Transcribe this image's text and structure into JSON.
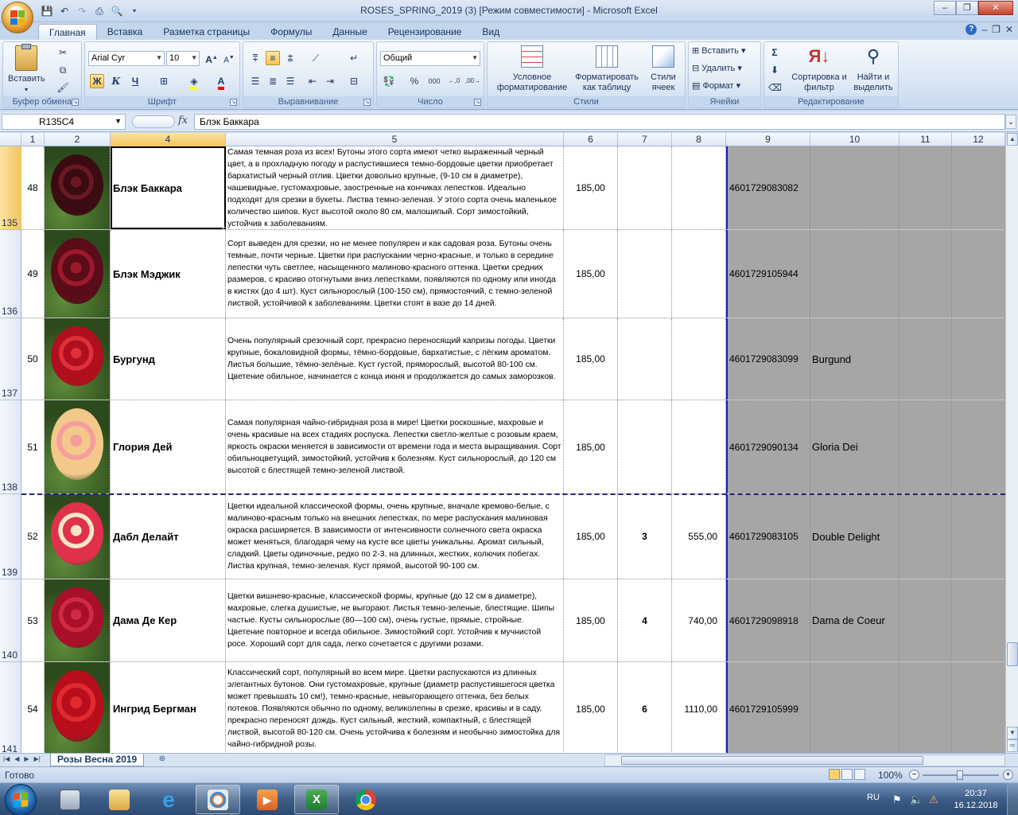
{
  "window": {
    "title": "ROSES_SPRING_2019 (3)  [Режим совместимости] - Microsoft Excel",
    "minimize": "–",
    "restore": "❐",
    "close": "✕"
  },
  "ribbon_tabs": [
    "Главная",
    "Вставка",
    "Разметка страницы",
    "Формулы",
    "Данные",
    "Рецензирование",
    "Вид"
  ],
  "ribbon": {
    "clipboard": {
      "label": "Буфер обмена",
      "paste": "Вставить"
    },
    "font": {
      "label": "Шрифт",
      "family": "Arial Cyr",
      "size": "10",
      "bold": "Ж",
      "italic": "К",
      "underline": "Ч"
    },
    "alignment": {
      "label": "Выравнивание"
    },
    "number": {
      "label": "Число",
      "format": "Общий",
      "percent": "%",
      "thousands": "000"
    },
    "styles": {
      "label": "Стили",
      "conditional": "Условное форматирование",
      "as_table": "Форматировать как таблицу",
      "cell_styles": "Стили ячеек"
    },
    "cells": {
      "label": "Ячейки",
      "insert": "Вставить",
      "delete": "Удалить",
      "format": "Формат"
    },
    "editing": {
      "label": "Редактирование",
      "sigma": "Σ",
      "sort": "Сортировка и фильтр",
      "find": "Найти и выделить"
    }
  },
  "formula_bar": {
    "name_box": "R135C4",
    "fx": "fx",
    "content": "Блэк Баккара"
  },
  "columns": [
    {
      "label": "1",
      "width": 29
    },
    {
      "label": "2",
      "width": 83
    },
    {
      "label": "4",
      "width": 145
    },
    {
      "label": "5",
      "width": 425
    },
    {
      "label": "6",
      "width": 68
    },
    {
      "label": "7",
      "width": 68
    },
    {
      "label": "8",
      "width": 68
    },
    {
      "label": "9",
      "width": 106
    },
    {
      "label": "10",
      "width": 112
    },
    {
      "label": "11",
      "width": 66
    },
    {
      "label": "12",
      "width": 67
    }
  ],
  "selected_column": "4",
  "rows": [
    {
      "rownum": "135",
      "n": "48",
      "name": "Блэк Баккара",
      "desc": "Самая темная роза из всех! Бутоны этого сорта имеют четко выраженный черный цвет, а в прохладную погоду и распустившиеся темно-бордовые цветки приобретает бархатистый черный отлив. Цветки довольно крупные, (9-10 см в диаметре), чашевидные, густомахровые, заостренные на кончиках лепестков. Идеально подходят для срезки в букеты. Листва темно-зеленая. У этого сорта очень маленькое количество шипов. Куст высотой около 80 см, малошипый. Сорт зимостойкий, устойчив к заболеваниям.",
      "price": "185,00",
      "qty": "",
      "sum": "",
      "barcode": "4601729083082",
      "latin": "",
      "rose_color": "#3a0c12",
      "rose_hi": "#6b1822"
    },
    {
      "rownum": "136",
      "n": "49",
      "name": "Блэк Мэджик",
      "desc": "Сорт выведен для срезки, но не менее популярен и как садовая роза. Бутоны очень темные, почти черные. Цветки при распускании черно-красные, и только в середине лепестки чуть светлее, насыщенного малиново-красного оттенка. Цветки средних размеров, с красиво отогнутыми вниз лепестками, появляются по одному или иногда в кистях (до 4 шт). Куст сильнорослый (100-150 см), прямостоячий, с темно-зеленой листвой, устойчивой к заболеваниям. Цветки стоят в вазе до 14 дней.",
      "price": "185,00",
      "qty": "",
      "sum": "",
      "barcode": "4601729105944",
      "latin": "",
      "rose_color": "#5a0c18",
      "rose_hi": "#9c1a2c"
    },
    {
      "rownum": "137",
      "n": "50",
      "name": "Бургунд",
      "desc": "Очень популярный срезочный сорт, прекрасно переносящий капризы погоды. Цветки крупные, бокаловидной формы, тёмно-бордовые, бархатистые, с лёгким ароматом. Листья большие, тёмно-зелёные. Куст густой, пряморослый, высотой 80-100 см. Цветение обильное, начинается с конца июня и продолжается до самых заморозков.",
      "price": "185,00",
      "qty": "",
      "sum": "",
      "barcode": "4601729083099",
      "latin": "Burgund",
      "rose_color": "#b0101e",
      "rose_hi": "#e0303a"
    },
    {
      "rownum": "138",
      "n": "51",
      "name": "Глория Дей",
      "desc": "Самая популярная чайно-гибридная роза в мире! Цветки роскошные, махровые и очень красивые на всех стадиях роспуска. Лепестки светло-желтые с розовым краем, яркость окраски меняется в зависимости от времени года и места выращивания. Сорт обильноцветущий, зимостойкий, устойчив к болезням. Куст сильнорослый, до 120 см высотой с блестящей темно-зеленой листвой.",
      "price": "185,00",
      "qty": "",
      "sum": "",
      "barcode": "4601729090134",
      "latin": "Gloria Dei",
      "rose_color": "#f2c98a",
      "rose_hi": "#f79c9c"
    },
    {
      "rownum": "139",
      "n": "52",
      "name": "Дабл Делайт",
      "desc": "Цветки идеальной классической формы, очень крупные, вначале кремово-белые, с малиново-красным только на внешних лепестках, по мере распускания малиновая окраска расширяется. В зависимости от интенсивности солнечного света окраска может меняться, благодаря чему на кусте все цветы уникальны. Аромат сильный, сладкий. Цветы одиночные, редко по 2-3, на длинных, жестких, колючих побегах. Листва крупная, темно-зеленая. Куст прямой, высотой 90-100 см.",
      "price": "185,00",
      "qty": "3",
      "sum": "555,00",
      "barcode": "4601729083105",
      "latin": "Double Delight",
      "rose_color": "#e0304a",
      "rose_hi": "#f6e6c8"
    },
    {
      "rownum": "140",
      "n": "53",
      "name": "Дама Де Кер",
      "desc": "Цветки вишнево-красные, классической формы, крупные (до 12 см в диаметре), махровые, слегка душистые, не выгорают. Листья темно-зеленые, блестящие. Шипы частые. Кусты сильнорослые (80—100 см), очень густые, прямые, стройные. Цветение повторное и всегда обильное. Зимостойкий сорт. Устойчив к мучнистой росе. Хороший сорт для сада, легко сочетается с другими розами.",
      "price": "185,00",
      "qty": "4",
      "sum": "740,00",
      "barcode": "4601729098918",
      "latin": "Dama de Coeur",
      "rose_color": "#a8102a",
      "rose_hi": "#d02a44"
    },
    {
      "rownum": "141",
      "n": "54",
      "name": "Ингрид Бергман",
      "desc": "Классический сорт, популярный во всем мире. Цветки распускаются из длинных элегантных бутонов. Они густомахровые, крупные (диаметр распустившегося цветка может превышать 10 см!), темно-красные, невыгорающего оттенка, без белых потеков. Появляются обычно по одному, великолепны в срезке, красивы и в саду, прекрасно переносят дождь. Куст сильный, жесткий, компактный, с блестящей листвой, высотой 80-120 см. Очень устойчива к болезням и необычно зимостойка для чайно-гибридной розы.",
      "price": "185,00",
      "qty": "6",
      "sum": "1110,00",
      "barcode": "4601729105999",
      "latin": "",
      "rose_color": "#b80e1c",
      "rose_hi": "#e02a30"
    }
  ],
  "sheet": {
    "tab_name": "Розы Весна 2019"
  },
  "status": {
    "ready": "Готово",
    "zoom": "100%"
  },
  "taskbar": {
    "lang": "RU",
    "time": "20:37",
    "date": "16.12.2018"
  },
  "colors": {
    "accent_tab": "#fbd06a",
    "gray_fill": "#a6a6a6",
    "page_break": "#23237e"
  }
}
